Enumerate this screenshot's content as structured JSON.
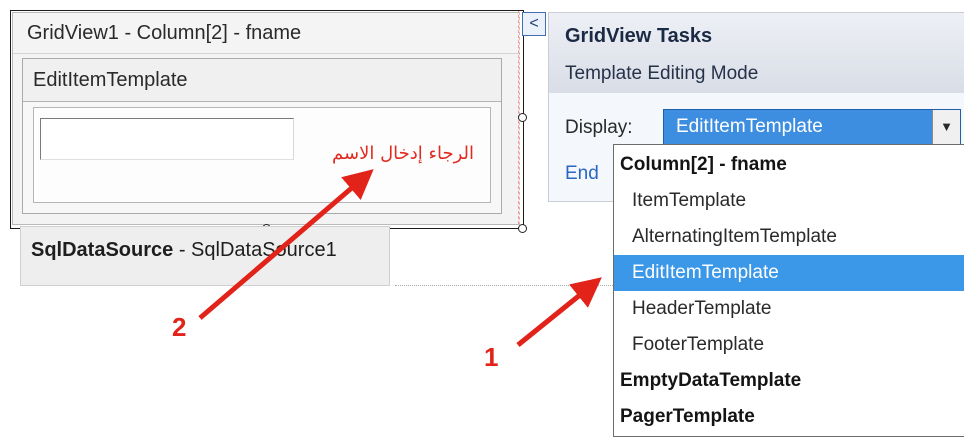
{
  "gridview": {
    "header": "GridView1 - Column[2] - fname",
    "template_label": "EditItemTemplate",
    "validator_text": "الرجاء إدخال الاسم"
  },
  "sqldatasource": {
    "type": "SqlDataSource",
    "separator": " - ",
    "id": "SqlDataSource1"
  },
  "tasks": {
    "collapse_glyph": "<",
    "title": "GridView Tasks",
    "subtitle": "Template Editing Mode",
    "display_label": "Display:",
    "display_value": "EditItemTemplate",
    "end_link": "End"
  },
  "dropdown": {
    "items": [
      {
        "label": "Column[2] - fname",
        "kind": "group"
      },
      {
        "label": "ItemTemplate",
        "kind": "child"
      },
      {
        "label": "AlternatingItemTemplate",
        "kind": "child"
      },
      {
        "label": "EditItemTemplate",
        "kind": "child",
        "selected": true
      },
      {
        "label": "HeaderTemplate",
        "kind": "child"
      },
      {
        "label": "FooterTemplate",
        "kind": "child"
      },
      {
        "label": "EmptyDataTemplate",
        "kind": "group"
      },
      {
        "label": "PagerTemplate",
        "kind": "group"
      }
    ]
  },
  "annotations": {
    "arrow_color": "#e2231a",
    "label_1": "1",
    "label_2": "2"
  },
  "colors": {
    "selection_blue": "#3b97e8",
    "annotation_red": "#e2231a",
    "validator_red": "#e02b20"
  }
}
